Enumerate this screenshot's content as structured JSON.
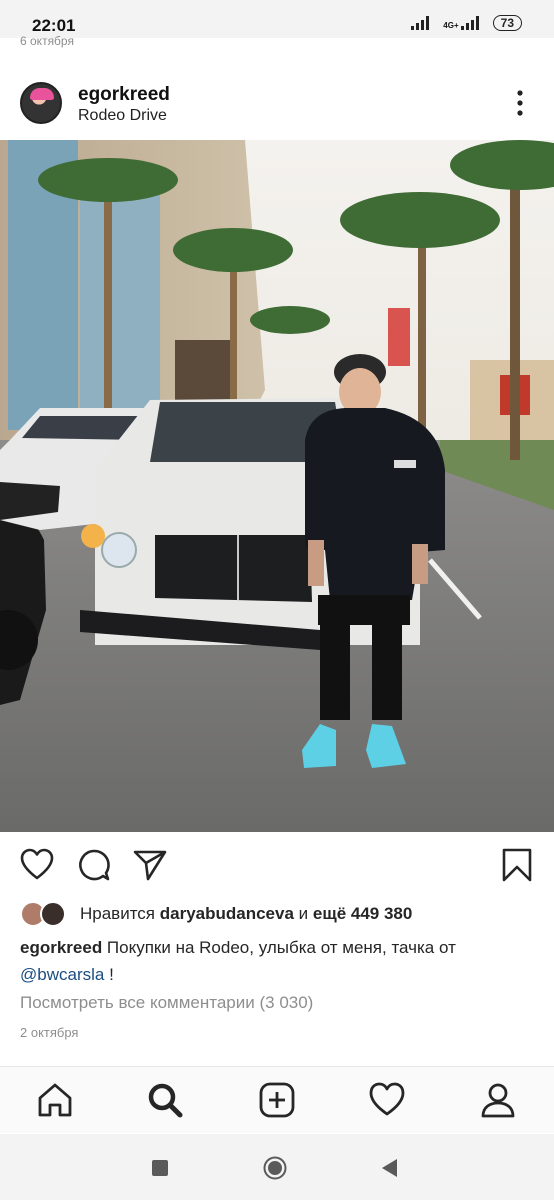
{
  "status_bar": {
    "time": "22:01",
    "network": "4G+",
    "battery": "73"
  },
  "previous_post_date": "6 октября",
  "post": {
    "username": "egorkreed",
    "location": "Rodeo Drive",
    "likes": {
      "prefix": "Нравится ",
      "user": "daryabudanceva",
      "middle": " и ",
      "rest": "ещё 449 380"
    },
    "caption": {
      "username": "egorkreed",
      "text": " Покупки на Rodeo, улыбка от меня, тачка от ",
      "mention": "@bwcarsla",
      "suffix": " !"
    },
    "view_comments": "Посмотреть все комментарии (3 030)",
    "date": "2 октября"
  },
  "icons": {
    "actions": [
      "heart-icon",
      "comment-icon",
      "share-icon",
      "bookmark-icon"
    ],
    "bottom_nav": [
      "home-icon",
      "search-icon",
      "add-post-icon",
      "activity-heart-icon",
      "profile-icon"
    ],
    "system_nav": [
      "recents-square-icon",
      "home-circle-icon",
      "back-triangle-icon"
    ]
  },
  "colors": {
    "mention": "#1c4e7f",
    "muted": "#8e8e8e",
    "text": "#262626"
  }
}
